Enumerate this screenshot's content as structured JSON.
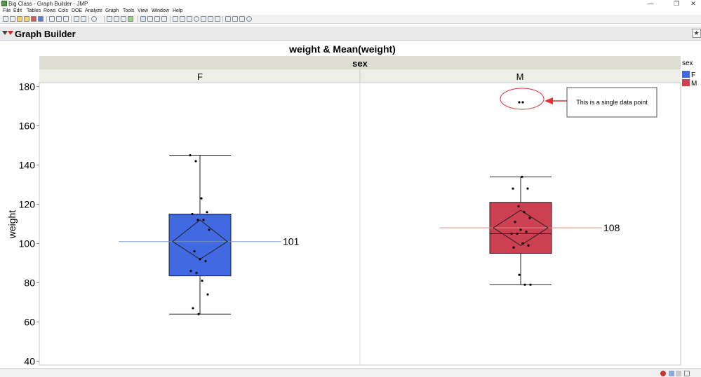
{
  "window": {
    "title": "Big Class - Graph Builder - JMP",
    "controls": [
      "—",
      "❐",
      "✕"
    ]
  },
  "menu": [
    "File",
    "Edit",
    "Tables",
    "Rows",
    "Cols",
    "DOE",
    "Analyze",
    "Graph",
    "Tools",
    "View",
    "Window",
    "Help"
  ],
  "panel": {
    "title": "Graph Builder"
  },
  "graph": {
    "title": "weight & Mean(weight)",
    "group_title": "sex",
    "panels": [
      "F",
      "M"
    ],
    "y_label": "weight",
    "y_ticks": [
      "40",
      "60",
      "80",
      "100",
      "120",
      "140",
      "160",
      "180"
    ],
    "legend": {
      "title": "sex",
      "items": [
        {
          "label": "F",
          "color": "#4169E1"
        },
        {
          "label": "M",
          "color": "#CD4052"
        }
      ]
    },
    "annotation": "This is a single data point"
  },
  "chart_data": {
    "type": "box",
    "ylim": [
      38,
      182
    ],
    "ylabel": "weight",
    "categories": [
      "F",
      "M"
    ],
    "series": [
      {
        "name": "F",
        "color": "#4169E1",
        "whisker_low": 64,
        "q1": 83.5,
        "median": 101,
        "q3": 115,
        "whisker_high": 145,
        "mean": 101,
        "mean_label": "101",
        "ci_low": 92,
        "ci_high": 112,
        "points": [
          145,
          142,
          123,
          116,
          115,
          112,
          112,
          107,
          96,
          92,
          91,
          86,
          85,
          81,
          74,
          67,
          64
        ]
      },
      {
        "name": "M",
        "color": "#CD4052",
        "whisker_low": 79,
        "q1": 95,
        "median": 105,
        "q3": 121,
        "whisker_high": 134,
        "mean": 108,
        "mean_label": "108",
        "ci_low": 99,
        "ci_high": 117,
        "points": [
          172,
          172,
          134,
          128,
          128,
          119,
          116,
          113,
          111,
          107,
          106,
          105,
          105,
          100,
          99,
          98,
          84,
          79,
          79
        ]
      }
    ]
  }
}
